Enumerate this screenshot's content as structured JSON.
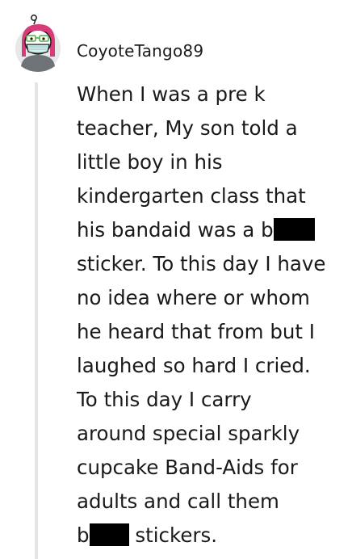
{
  "comment": {
    "username": "CoyoteTango89",
    "avatar_icon": "reddit-snoo-avatar-with-mask",
    "lines": [
      "When I was a pre k",
      "teacher, My son told a",
      "little boy in his",
      "kindergarten class that",
      "his bandaid was a b",
      "sticker. To this day I have",
      "no idea where or whom",
      "he heard that from but I",
      "laughed so hard I cried.",
      "To this day I carry",
      "around special sparkly",
      "cupcake Band-Aids for",
      "adults and call them",
      "b",
      "stickers."
    ]
  },
  "colors": {
    "text": "#1a1a1b",
    "thread_line": "#e5e5e5",
    "redaction": "#000000",
    "avatar_hair": "#d83a7a",
    "avatar_shirt": "#6f7276",
    "avatar_mask": "#d2ecec"
  }
}
